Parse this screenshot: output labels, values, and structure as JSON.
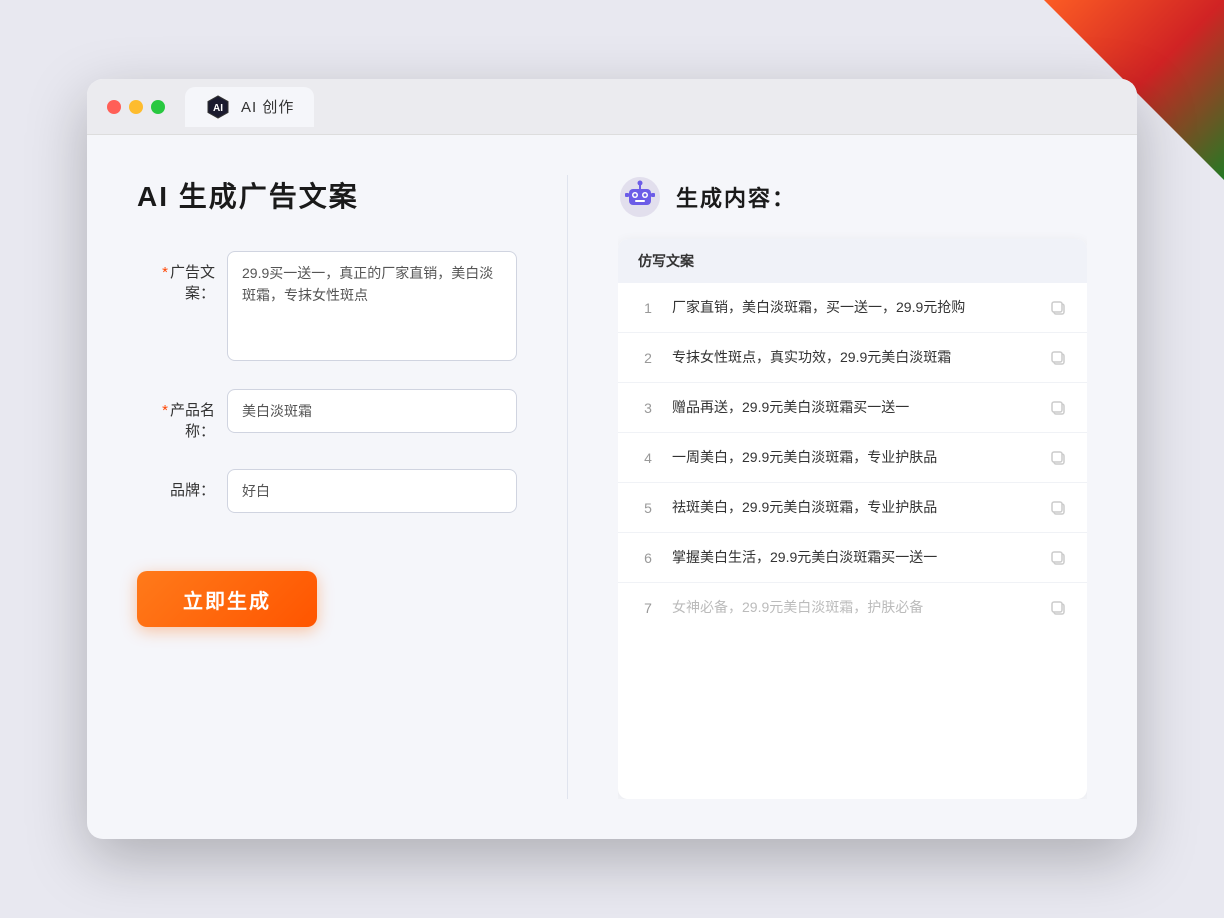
{
  "background_decoration": "top-right triangle",
  "browser": {
    "tab_title": "AI 创作",
    "traffic_lights": [
      "red",
      "yellow",
      "green"
    ]
  },
  "left_panel": {
    "page_title": "AI 生成广告文案",
    "form": {
      "ad_copy_label": "广告文案：",
      "ad_copy_required": true,
      "ad_copy_value": "29.9买一送一，真正的厂家直销，美白淡斑霜，专抹女性斑点",
      "product_name_label": "产品名称：",
      "product_name_required": true,
      "product_name_value": "美白淡斑霜",
      "brand_label": "品牌：",
      "brand_required": false,
      "brand_value": "好白"
    },
    "generate_button": "立即生成"
  },
  "right_panel": {
    "result_title": "生成内容：",
    "table_header": "仿写文案",
    "rows": [
      {
        "num": 1,
        "text": "厂家直销，美白淡斑霜，买一送一，29.9元抢购",
        "muted": false
      },
      {
        "num": 2,
        "text": "专抹女性斑点，真实功效，29.9元美白淡斑霜",
        "muted": false
      },
      {
        "num": 3,
        "text": "赠品再送，29.9元美白淡斑霜买一送一",
        "muted": false
      },
      {
        "num": 4,
        "text": "一周美白，29.9元美白淡斑霜，专业护肤品",
        "muted": false
      },
      {
        "num": 5,
        "text": "祛斑美白，29.9元美白淡斑霜，专业护肤品",
        "muted": false
      },
      {
        "num": 6,
        "text": "掌握美白生活，29.9元美白淡斑霜买一送一",
        "muted": false
      },
      {
        "num": 7,
        "text": "女神必备，29.9元美白淡斑霜，护肤必备",
        "muted": true
      }
    ]
  }
}
